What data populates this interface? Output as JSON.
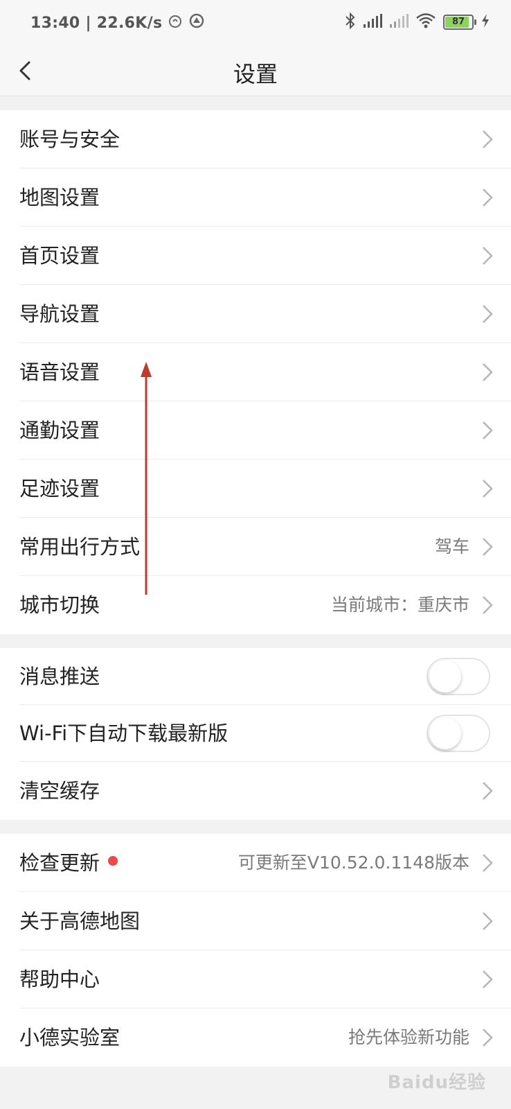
{
  "status_bar": {
    "time_speed": "13:40 | 22.6K/s",
    "battery_level": "87"
  },
  "header": {
    "title": "设置"
  },
  "group1": {
    "items": [
      {
        "label": "账号与安全"
      },
      {
        "label": "地图设置"
      },
      {
        "label": "首页设置"
      },
      {
        "label": "导航设置"
      },
      {
        "label": "语音设置"
      },
      {
        "label": "通勤设置"
      },
      {
        "label": "足迹设置"
      },
      {
        "label": "常用出行方式",
        "value": "驾车"
      },
      {
        "label": "城市切换",
        "value": "当前城市：重庆市"
      }
    ]
  },
  "group2": {
    "items": [
      {
        "label": "消息推送",
        "toggle": false
      },
      {
        "label": "Wi-Fi下自动下载最新版",
        "toggle": false
      },
      {
        "label": "清空缓存"
      }
    ]
  },
  "group3": {
    "items": [
      {
        "label": "检查更新",
        "value": "可更新至V10.52.0.1148版本"
      },
      {
        "label": "关于高德地图"
      },
      {
        "label": "帮助中心"
      },
      {
        "label": "小德实验室",
        "value": "抢先体验新功能"
      }
    ]
  },
  "watermark": "Baidu经验",
  "colors": {
    "accent_red": "#f04848",
    "annotation_arrow": "#c0392b"
  }
}
